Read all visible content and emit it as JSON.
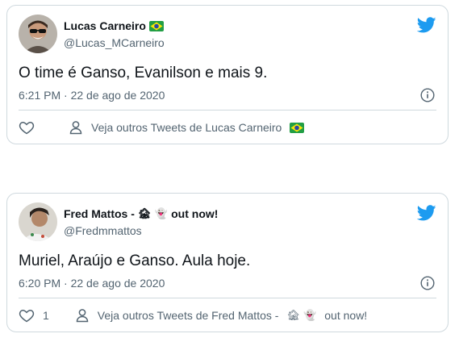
{
  "tweets": [
    {
      "author_name": "Lucas Carneiro",
      "author_flag": "brazil-flag",
      "handle": "@Lucas_MCarneiro",
      "text": "O time é Ganso, Evanilson e mais 9.",
      "time": "6:21 PM",
      "date": "22 de ago de 2020",
      "likes": "",
      "see_more": "Veja outros Tweets de Lucas Carneiro",
      "see_more_flag": "brazil-flag"
    },
    {
      "author_name": "Fred Mattos -",
      "author_emojis": "🏚 👻",
      "author_suffix": "out now!",
      "handle": "@Fredmmattos",
      "text": "Muriel, Araújo e Ganso. Aula hoje.",
      "time": "6:20 PM",
      "date": "22 de ago de 2020",
      "likes": "1",
      "see_more": "Veja outros Tweets de Fred Mattos -",
      "see_more_emojis": "🏚 👻",
      "see_more_suffix": "out now!"
    }
  ],
  "meta_separator": "·",
  "colors": {
    "twitter_blue": "#1d9bf0",
    "muted": "#536471",
    "border": "#cfd9de"
  }
}
